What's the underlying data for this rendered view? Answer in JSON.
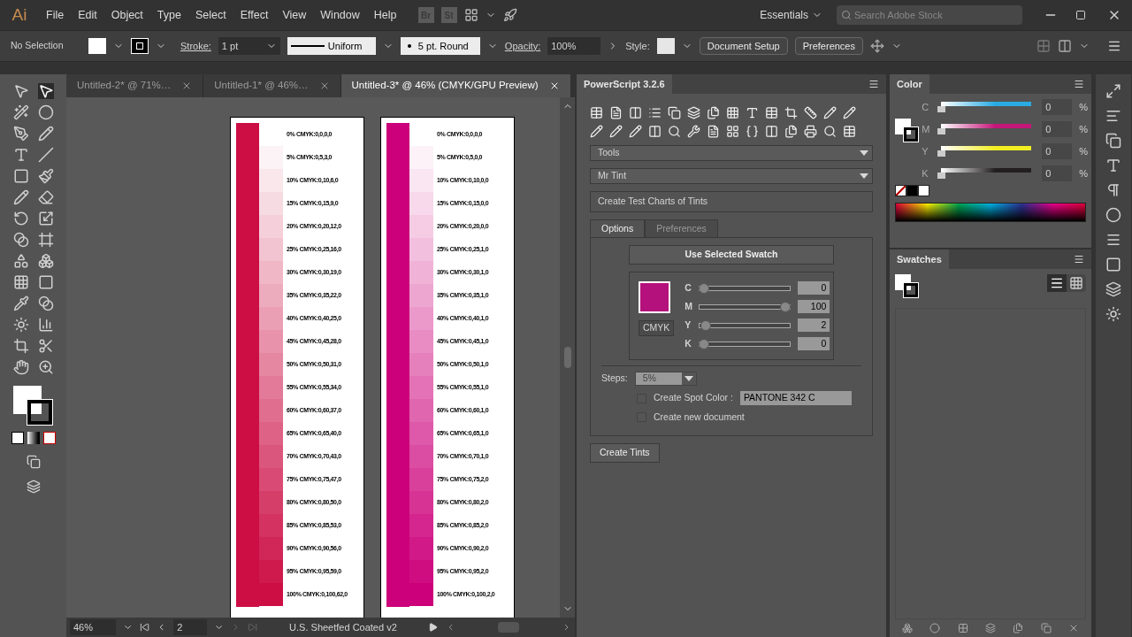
{
  "app": {
    "logo": "Ai",
    "menu": [
      "File",
      "Edit",
      "Object",
      "Type",
      "Select",
      "Effect",
      "View",
      "Window",
      "Help"
    ],
    "bridge_buttons": [
      "Br",
      "St"
    ],
    "workspace": "Essentials"
  },
  "search": {
    "placeholder": "Search Adobe Stock"
  },
  "control_bar": {
    "selection": "No Selection",
    "stroke_label": "Stroke:",
    "stroke_weight": "1 pt",
    "profile": "Uniform",
    "brush": "5 pt. Round",
    "opacity_label": "Opacity:",
    "opacity": "100%",
    "style_label": "Style:",
    "buttons": [
      "Document Setup",
      "Preferences"
    ]
  },
  "doc_tabs": [
    {
      "title": "Untitled-2* @ 71%…",
      "selected": false
    },
    {
      "title": "Untitled-1* @ 46%…",
      "selected": false
    },
    {
      "title": "Untitled-3* @ 46% (CMYK/GPU Preview)",
      "selected": true
    }
  ],
  "artboards": [
    {
      "color": "#cc0e45",
      "header": "0% CMYK:0,0,0,0",
      "steps": [
        {
          "label": "5% CMYK:0,5,3,0",
          "color": "#fcf3f6"
        },
        {
          "label": "10% CMYK:0,10,6,0",
          "color": "#fae7ec"
        },
        {
          "label": "15% CMYK:0,15,9,0",
          "color": "#f7dbe3"
        },
        {
          "label": "20% CMYK:0,20,12,0",
          "color": "#f5cfda"
        },
        {
          "label": "25% CMYK:0,25,16,0",
          "color": "#f2c3d1"
        },
        {
          "label": "30% CMYK:0,30,19,0",
          "color": "#f0b7c7"
        },
        {
          "label": "35% CMYK:0,35,22,0",
          "color": "#edabbe"
        },
        {
          "label": "40% CMYK:0,40,25,0",
          "color": "#eb9fb5"
        },
        {
          "label": "45% CMYK:0,45,28,0",
          "color": "#e893ab"
        },
        {
          "label": "50% CMYK:0,50,31,0",
          "color": "#e687a2"
        },
        {
          "label": "55% CMYK:0,55,34,0",
          "color": "#e37a99"
        },
        {
          "label": "60% CMYK:0,60,37,0",
          "color": "#e06e8f"
        },
        {
          "label": "65% CMYK:0,65,40,0",
          "color": "#de6286"
        },
        {
          "label": "70% CMYK:0,70,43,0",
          "color": "#db567d"
        },
        {
          "label": "75% CMYK:0,75,47,0",
          "color": "#d94a74"
        },
        {
          "label": "80% CMYK:0,80,50,0",
          "color": "#d63e6a"
        },
        {
          "label": "85% CMYK:0,85,53,0",
          "color": "#d43261"
        },
        {
          "label": "90% CMYK:0,90,56,0",
          "color": "#d12658"
        },
        {
          "label": "95% CMYK:0,95,59,0",
          "color": "#cf1a4e"
        },
        {
          "label": "100% CMYK:0,100,62,0",
          "color": "#cc0e45"
        }
      ]
    },
    {
      "color": "#cc007a",
      "header": "0% CMYK:0,0,0,0",
      "steps": [
        {
          "label": "5% CMYK:0,5,0,0",
          "color": "#fcf2f8"
        },
        {
          "label": "10% CMYK:0,10,0,0",
          "color": "#fae6f2"
        },
        {
          "label": "15% CMYK:0,15,0,0",
          "color": "#f7d9eb"
        },
        {
          "label": "20% CMYK:0,20,0,0",
          "color": "#f5cce4"
        },
        {
          "label": "25% CMYK:0,25,1,0",
          "color": "#f2bfde"
        },
        {
          "label": "30% CMYK:0,30,1,0",
          "color": "#f0b3d7"
        },
        {
          "label": "35% CMYK:0,35,1,0",
          "color": "#eda6d0"
        },
        {
          "label": "40% CMYK:0,40,1,0",
          "color": "#eb99ca"
        },
        {
          "label": "45% CMYK:0,45,1,0",
          "color": "#e88cc3"
        },
        {
          "label": "50% CMYK:0,50,1,0",
          "color": "#e680bc"
        },
        {
          "label": "55% CMYK:0,55,1,0",
          "color": "#e373b6"
        },
        {
          "label": "60% CMYK:0,60,1,0",
          "color": "#e066af"
        },
        {
          "label": "65% CMYK:0,65,1,0",
          "color": "#de59a9"
        },
        {
          "label": "70% CMYK:0,70,1,0",
          "color": "#db4da2"
        },
        {
          "label": "75% CMYK:0,75,2,0",
          "color": "#d9409b"
        },
        {
          "label": "80% CMYK:0,80,2,0",
          "color": "#d63395"
        },
        {
          "label": "85% CMYK:0,85,2,0",
          "color": "#d4268e"
        },
        {
          "label": "90% CMYK:0,90,2,0",
          "color": "#d11a87"
        },
        {
          "label": "95% CMYK:0,95,2,0",
          "color": "#cf0d81"
        },
        {
          "label": "100% CMYK:0,100,2,0",
          "color": "#cc007a"
        }
      ]
    }
  ],
  "status_bar": {
    "zoom": "46%",
    "artboard": "2",
    "profile": "U.S. Sheetfed Coated v2"
  },
  "powerscript": {
    "title": "PowerScript 3.2.6",
    "category": "Tools",
    "script": "Mr Tint",
    "description": "Create Test Charts of Tints",
    "tabs": [
      {
        "label": "Options",
        "selected": true
      },
      {
        "label": "Preferences",
        "selected": false
      }
    ],
    "swatch_button": "Use Selected Swatch",
    "swatch": {
      "color": "#b5117c"
    },
    "mode_button": "CMYK",
    "channels": [
      {
        "name": "C",
        "level": 0,
        "value": "0"
      },
      {
        "name": "M",
        "level": 1,
        "value": "100"
      },
      {
        "name": "Y",
        "level": 0.02,
        "value": "2"
      },
      {
        "name": "K",
        "level": 0,
        "value": "0"
      }
    ],
    "steps_label": "Steps:",
    "steps": "5%",
    "options": [
      {
        "label": "Create Spot Color :",
        "checked": false,
        "value": "PANTONE 342 C"
      },
      {
        "label": "Create new document",
        "checked": false
      }
    ],
    "run_button": "Create Tints"
  },
  "color_panel": {
    "title": "Color",
    "channels": [
      {
        "name": "C",
        "value": "0",
        "unit": "%",
        "level": 0,
        "color": "#29abe2"
      },
      {
        "name": "M",
        "value": "0",
        "unit": "%",
        "level": 0,
        "color": "#c4177a"
      },
      {
        "name": "Y",
        "value": "0",
        "unit": "%",
        "level": 0,
        "color": "#f2ee22"
      },
      {
        "name": "K",
        "value": "0",
        "unit": "%",
        "level": 0,
        "color": "#231f20"
      }
    ]
  },
  "swatches_panel": {
    "title": "Swatches",
    "views": [
      {
        "kind": "list",
        "selected": true
      },
      {
        "kind": "grid",
        "selected": false
      }
    ]
  }
}
